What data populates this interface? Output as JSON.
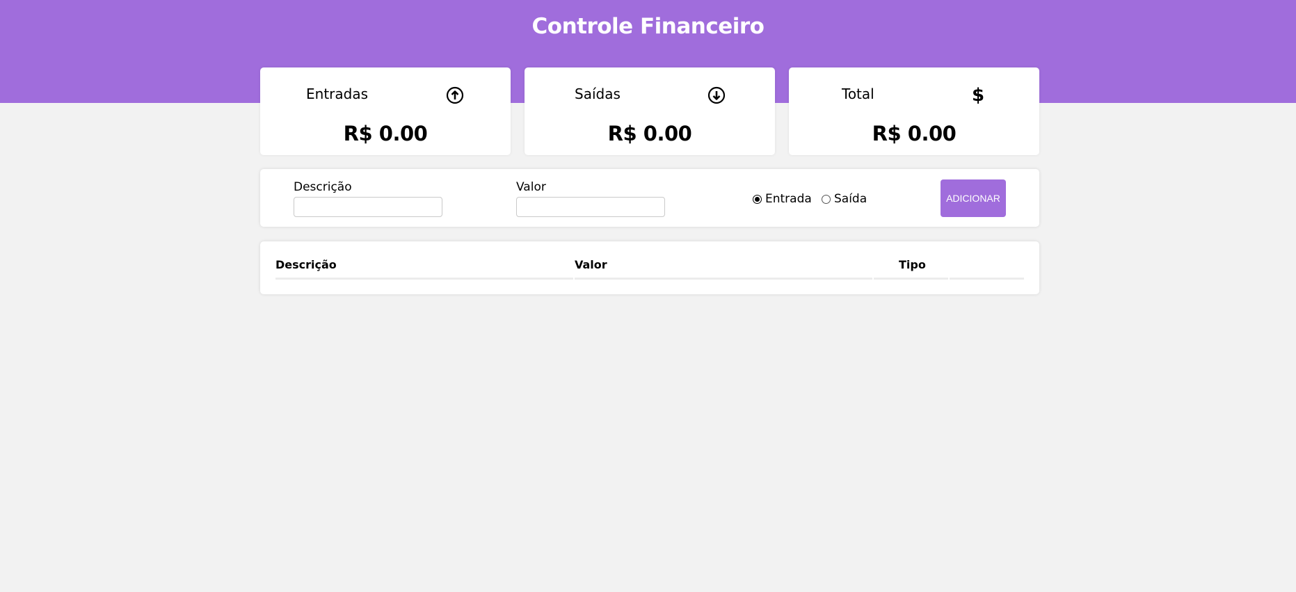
{
  "header": {
    "title": "Controle Financeiro"
  },
  "colors": {
    "accent": "#a06ddc",
    "background": "#f2f2f2"
  },
  "summary": [
    {
      "title": "Entradas",
      "icon": "arrow-up-circle-icon",
      "value": "R$ 0.00"
    },
    {
      "title": "Saídas",
      "icon": "arrow-down-circle-icon",
      "value": "R$ 0.00"
    },
    {
      "title": "Total",
      "icon": "dollar-icon",
      "value": "R$ 0.00",
      "icon_glyph": "$"
    }
  ],
  "form": {
    "description_label": "Descrição",
    "description_value": "",
    "amount_label": "Valor",
    "amount_value": "",
    "type_options": [
      {
        "label": "Entrada",
        "selected": true
      },
      {
        "label": "Saída",
        "selected": false
      }
    ],
    "add_label": "ADICIONAR"
  },
  "table": {
    "columns": [
      "Descrição",
      "Valor",
      "Tipo"
    ],
    "rows": []
  }
}
